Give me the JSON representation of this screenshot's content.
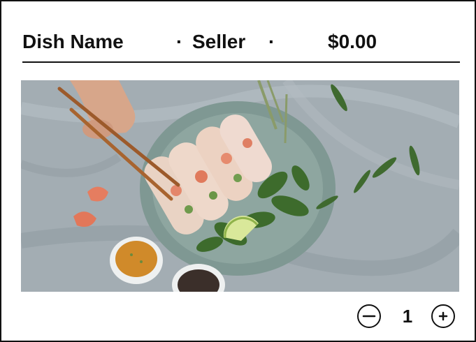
{
  "header": {
    "dish_name": "Dish Name",
    "separator": "·",
    "seller": "Seller",
    "price": "$0.00"
  },
  "image": {
    "subject": "fresh spring rolls with shrimp, herbs, lime and dipping sauces",
    "icon": "food-photo"
  },
  "quantity": {
    "value": "1",
    "decrement_icon": "minus-circle-icon",
    "increment_icon": "plus-circle-icon"
  },
  "colors": {
    "text": "#111111",
    "border": "#111111",
    "background": "#ffffff"
  }
}
